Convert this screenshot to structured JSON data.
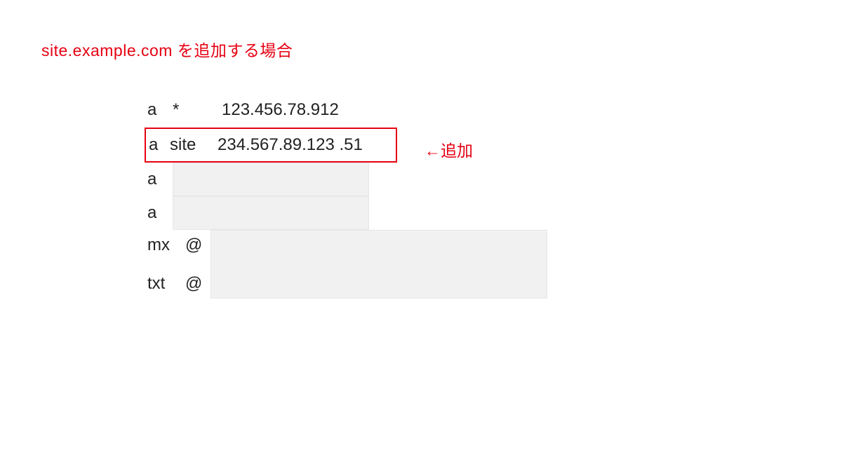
{
  "heading": "site.example.com を追加する場合",
  "rows": [
    {
      "type": "a",
      "name": "*",
      "value": "123.456.78.912"
    },
    {
      "type": "a",
      "name": "site",
      "value": "234.567.89.123 .51"
    },
    {
      "type": "a"
    },
    {
      "type": "a"
    },
    {
      "type": "mx",
      "name": "@"
    },
    {
      "type": "txt",
      "name": "@"
    }
  ],
  "annotation": "←追加"
}
